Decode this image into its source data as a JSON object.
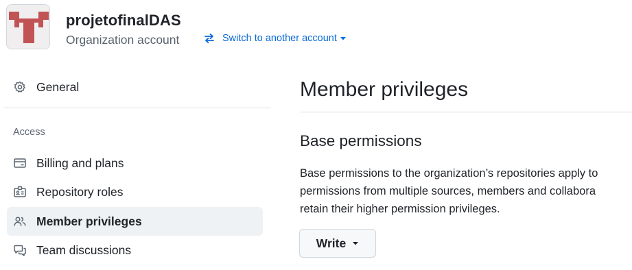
{
  "header": {
    "org_name": "projetofinalDAS",
    "account_type": "Organization account",
    "switch_label": "Switch to another account"
  },
  "sidebar": {
    "general_label": "General",
    "access_heading": "Access",
    "items": [
      {
        "label": "Billing and plans",
        "icon": "credit-card-icon"
      },
      {
        "label": "Repository roles",
        "icon": "id-badge-icon"
      },
      {
        "label": "Member privileges",
        "icon": "people-icon",
        "active": true
      },
      {
        "label": "Team discussions",
        "icon": "comment-discussion-icon"
      }
    ]
  },
  "main": {
    "title": "Member privileges",
    "section_title": "Base permissions",
    "description_lines": [
      "Base permissions to the organization’s repositories apply to",
      "permissions from multiple sources, members and collabora",
      "retain their higher permission privileges."
    ],
    "permission_value": "Write"
  },
  "colors": {
    "link": "#0969da",
    "avatar_mark": "#c25355",
    "active_bg": "#eff2f5",
    "muted_text": "#59636e"
  }
}
